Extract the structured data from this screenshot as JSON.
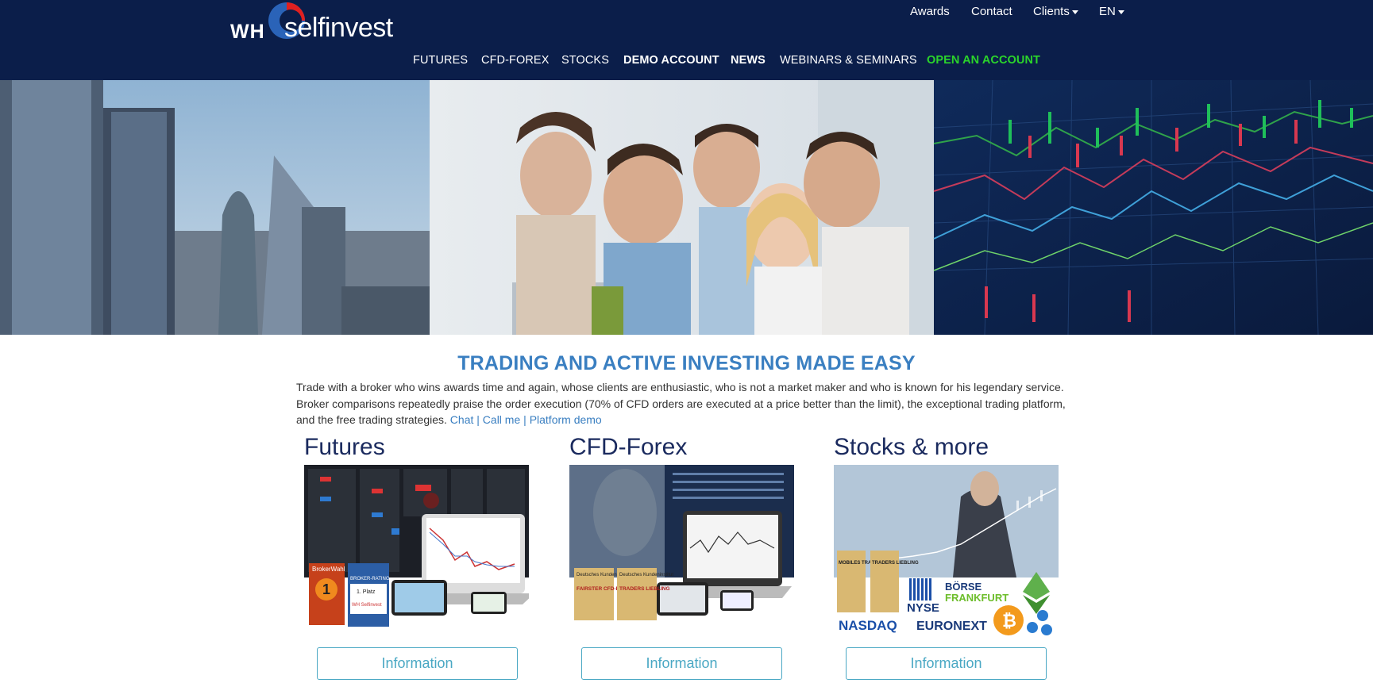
{
  "logo": {
    "prefix": "WH",
    "name": "selfinvest"
  },
  "topnav": {
    "awards": "Awards",
    "contact": "Contact",
    "clients": "Clients",
    "language": "EN"
  },
  "mainnav": {
    "futures": "FUTURES",
    "cfd_forex": "CFD-FOREX",
    "stocks": "STOCKS",
    "demo": "DEMO ACCOUNT",
    "news": "NEWS",
    "webinars": "WEBINARS & SEMINARS",
    "open_account": "OPEN AN ACCOUNT"
  },
  "colors": {
    "header_bg": "#0b1e4a",
    "accent_blue": "#3a7fc1",
    "open_account_green": "#2bd42b",
    "button_border": "#4aa8c4"
  },
  "content": {
    "headline": "TRADING AND ACTIVE INVESTING MADE EASY",
    "intro": "Trade with a broker who wins awards time and again, whose clients are enthusiastic, who is not a market maker and who is known for his legendary service. Broker comparisons repeatedly praise the order execution (70% of CFD orders are executed at a price better than the limit), the exceptional trading platform, and the free trading strategies.",
    "links": {
      "chat": "Chat",
      "sep": "|",
      "call": "Call me",
      "demo": "Platform demo"
    }
  },
  "products": [
    {
      "title": "Futures",
      "button": "Information"
    },
    {
      "title": "CFD-Forex",
      "button": "Information"
    },
    {
      "title": "Stocks & more",
      "button": "Information"
    }
  ],
  "badges": {
    "futures": {
      "broker_wahl": "BrokerWahl",
      "rank": "1",
      "broker_rating": "BROKER-RATING",
      "platz": "1. Platz",
      "wh": "WH Selfinvest"
    },
    "cfd": {
      "dki": "Deutsches Kundeninstitut",
      "fairster": "FAIRSTER CFD-BROKER",
      "traders": "TRADERS LIEBLING"
    },
    "stocks": {
      "mobiles": "MOBILES TRADEN",
      "traders": "TRADERS LIEBLING",
      "nyse": "NYSE",
      "nasdaq": "NASDAQ",
      "boerse": "BÖRSE",
      "frankfurt": "FRANKFURT",
      "euronext": "EURONEXT"
    }
  }
}
